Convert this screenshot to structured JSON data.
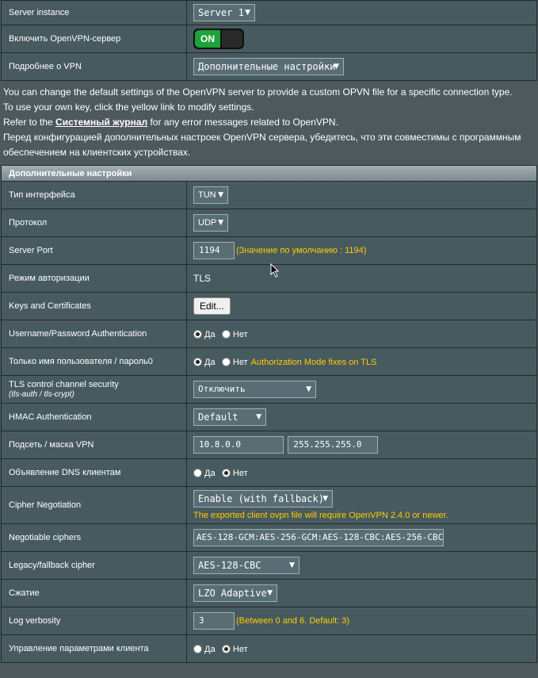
{
  "top": {
    "server_instance_label": "Server instance",
    "server_instance_value": "Server 1",
    "enable_label": "Включить OpenVPN-сервер",
    "toggle_on": "ON",
    "vpn_details_label": "Подробнее о VPN",
    "vpn_details_value": "Дополнительные настройки"
  },
  "description": {
    "line1": "You can change the default settings of the OpenVPN server to provide a custom OPVN file for a specific connection type.",
    "line2": "To use your own key, click the yellow link to modify settings.",
    "line3_pre": "Refer to the ",
    "line3_link": "Системный журнал",
    "line3_post": " for any error messages related to OpenVPN.",
    "line4": "Перед конфигурацией дополнительных настроек OpenVPN сервера, убедитесь, что эти совместимы с программным обеспечением на клиентских устройствах."
  },
  "section_title": "Дополнительные настройки",
  "adv": {
    "interface_type_label": "Тип интерфейса",
    "interface_type_value": "TUN",
    "protocol_label": "Протокол",
    "protocol_value": "UDP",
    "server_port_label": "Server Port",
    "server_port_value": "1194",
    "server_port_hint": "(Значение по умолчанию : 1194)",
    "auth_mode_label": "Режим авторизации",
    "auth_mode_value": "TLS",
    "keys_label": "Keys and Certificates",
    "keys_button": "Edit...",
    "userpass_label": "Username/Password Authentication",
    "yes": "Да",
    "no": "Нет",
    "useronly_label": "Только имя пользователя / пароль0",
    "useronly_hint": "Authorization Mode fixes on TLS",
    "tls_label": "TLS control channel security",
    "tls_sub": "(tls-auth / tls-crypt)",
    "tls_value": "Отключить",
    "hmac_label": "HMAC Authentication",
    "hmac_value": "Default",
    "subnet_label": "Подсеть / маска VPN",
    "subnet_value": "10.8.0.0",
    "mask_value": "255.255.255.0",
    "dns_label": "Объявление DNS клиентам",
    "cipher_neg_label": "Cipher Negotiation",
    "cipher_neg_value": "Enable (with fallback)",
    "cipher_neg_notice": "The exported client ovpn file will require OpenVPN 2.4.0 or newer.",
    "neg_ciphers_label": "Negotiable ciphers",
    "neg_ciphers_value": "AES-128-GCM:AES-256-GCM:AES-128-CBC:AES-256-CBC",
    "legacy_label": "Legacy/fallback cipher",
    "legacy_value": "AES-128-CBC",
    "compression_label": "Сжатие",
    "compression_value": "LZO Adaptive",
    "verbosity_label": "Log verbosity",
    "verbosity_value": "3",
    "verbosity_hint": "(Between 0 and 6. Default: 3)",
    "client_mgmt_label": "Управление параметрами клиента"
  },
  "colors": {
    "background": "#4d595d",
    "cell": "#475a5f",
    "hint": "#ffcc00",
    "toggle_on": "#1ea23a"
  }
}
